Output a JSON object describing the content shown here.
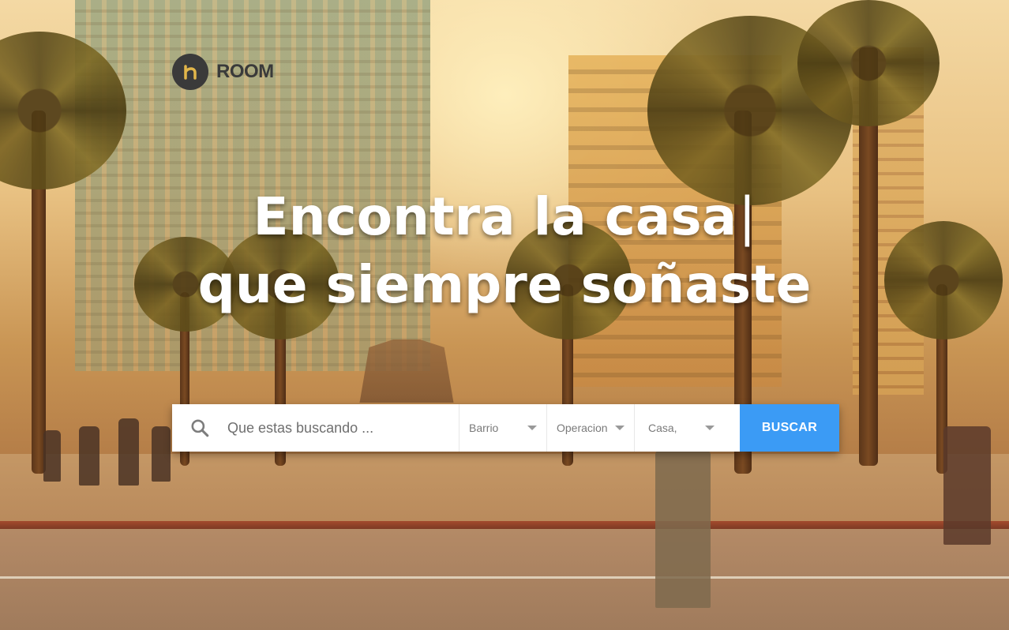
{
  "brand": {
    "name": "ROOM",
    "logo_color": "#3a3a3a",
    "logo_icon": "home-h-logo-icon"
  },
  "hero": {
    "headline_line1": "Encontra la casa",
    "cursor": "|",
    "headline_line2": "que siempre soñaste"
  },
  "search": {
    "icon": "search-icon",
    "placeholder": "Que estas buscando ...",
    "value": "",
    "barrio": {
      "selected": "Barrio",
      "icon": "chevron-down-icon"
    },
    "operacion": {
      "selected": "Operacion",
      "icon": "chevron-down-icon"
    },
    "tipo": {
      "selected": "Casa,",
      "icon": "chevron-down-icon"
    },
    "button_label": "BUSCAR",
    "button_color": "#3b9bf5"
  }
}
